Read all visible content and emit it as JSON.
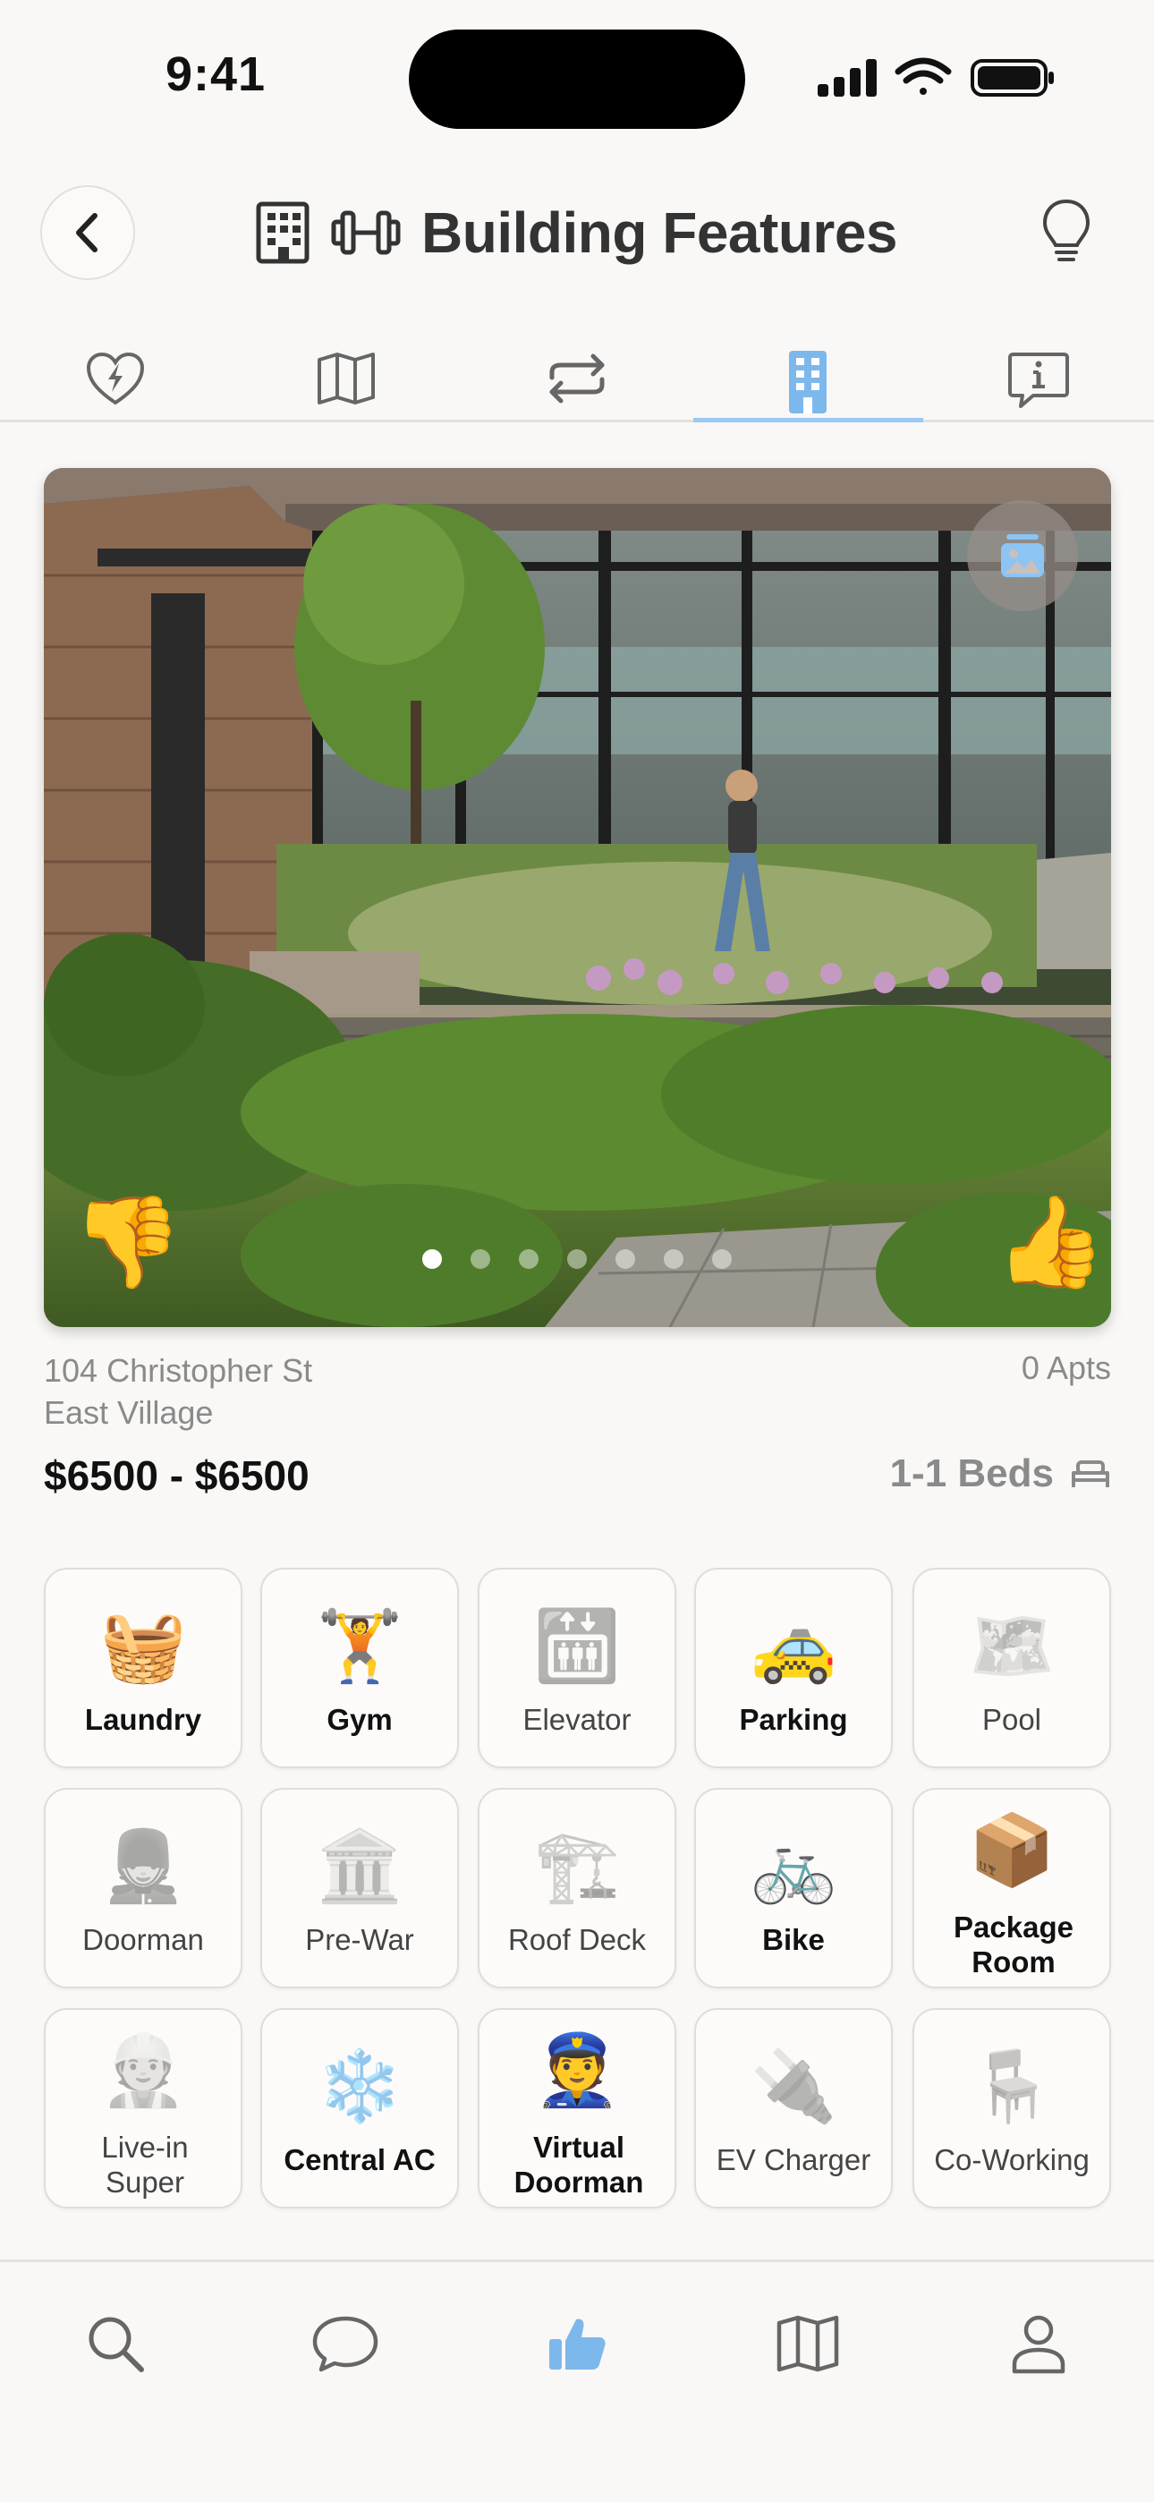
{
  "status_bar": {
    "time": "9:41"
  },
  "header": {
    "title": "Building Features"
  },
  "tabs": [
    {
      "name": "activity",
      "icon": "heart-bolt-icon"
    },
    {
      "name": "map",
      "icon": "map-icon"
    },
    {
      "name": "switch",
      "icon": "arrows-swap-icon"
    },
    {
      "name": "building",
      "icon": "building-icon",
      "active": true
    },
    {
      "name": "info",
      "icon": "info-bubble-icon"
    }
  ],
  "gallery": {
    "page_count": 7,
    "current_page": 1,
    "dislike_icon": "👎",
    "like_icon": "👍"
  },
  "listing": {
    "address_line1": "104 Christopher St",
    "address_line2": "East Village",
    "apts": "0 Apts",
    "price": "$6500 - $6500",
    "beds": "1-1 Beds"
  },
  "features": [
    {
      "label": "Laundry",
      "icon": "🧺",
      "enabled": true
    },
    {
      "label": "Gym",
      "icon": "🏋️",
      "enabled": true
    },
    {
      "label": "Elevator",
      "icon": "🛗",
      "enabled": false
    },
    {
      "label": "Parking",
      "icon": "🚕",
      "enabled": true
    },
    {
      "label": "Pool",
      "icon": "🗺️",
      "enabled": false
    },
    {
      "label": "Doorman",
      "icon": "💂",
      "enabled": false
    },
    {
      "label": "Pre-War",
      "icon": "🏛️",
      "enabled": false
    },
    {
      "label": "Roof Deck",
      "icon": "🏗️",
      "enabled": false
    },
    {
      "label": "Bike",
      "icon": "🚲",
      "enabled": true
    },
    {
      "label": "Package Room",
      "icon": "📦",
      "enabled": true
    },
    {
      "label": "Live-in Super",
      "icon": "👷",
      "enabled": false
    },
    {
      "label": "Central AC",
      "icon": "❄️",
      "enabled": true
    },
    {
      "label": "Virtual Doorman",
      "icon": "👮",
      "enabled": true
    },
    {
      "label": "EV Charger",
      "icon": "🔌",
      "enabled": false
    },
    {
      "label": "Co-Working",
      "icon": "🪑",
      "enabled": false
    }
  ],
  "bottom_nav": [
    {
      "name": "search",
      "icon": "search-icon"
    },
    {
      "name": "messages",
      "icon": "chat-bubble-icon"
    },
    {
      "name": "likes",
      "icon": "thumbs-up-icon",
      "active": true
    },
    {
      "name": "map",
      "icon": "map-icon"
    },
    {
      "name": "profile",
      "icon": "person-icon"
    }
  ],
  "colors": {
    "accent": "#7db8ec",
    "background": "#f9f8f6",
    "muted_text": "#8a8a8a"
  }
}
